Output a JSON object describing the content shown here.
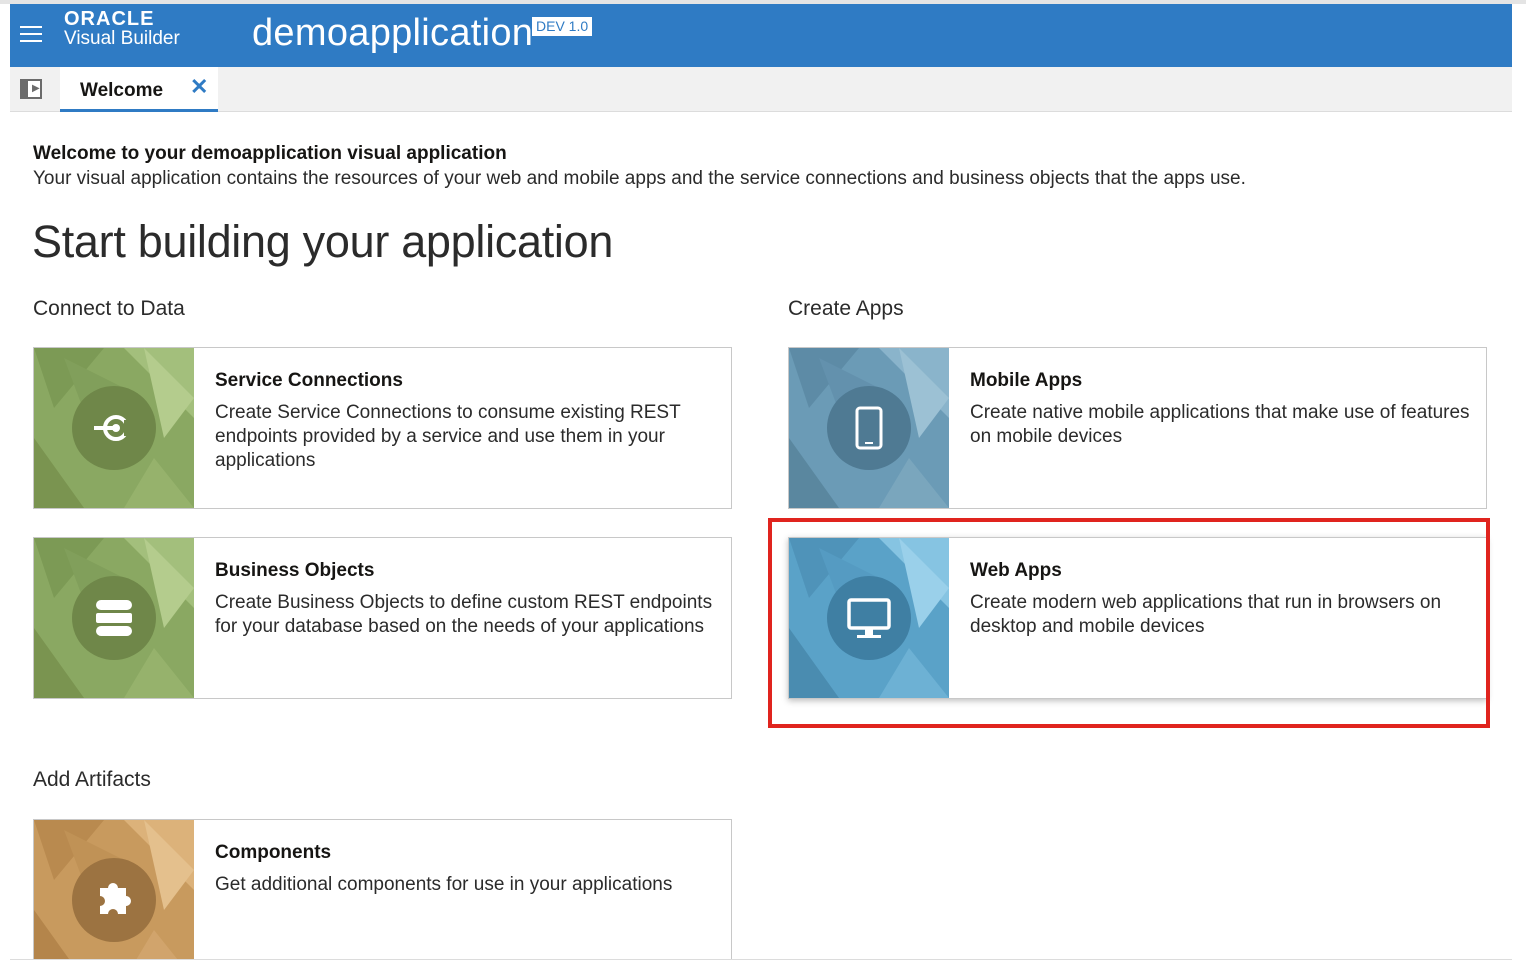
{
  "header": {
    "brand_oracle": "ORACLE",
    "brand_product": "Visual Builder",
    "app_name": "demoapplication",
    "version_badge": "DEV 1.0",
    "color": "#2f7bc4"
  },
  "tabs": [
    {
      "label": "Welcome",
      "close": "✕"
    }
  ],
  "welcome": {
    "title": "Welcome to your demoapplication visual application",
    "description": "Your visual application contains the resources of your web and mobile apps and the service connections and business objects that the apps use."
  },
  "main": {
    "heading": "Start building your application",
    "sections": {
      "connect": "Connect to Data",
      "create": "Create Apps",
      "artifacts": "Add Artifacts"
    }
  },
  "cards": {
    "service_connections": {
      "title": "Service Connections",
      "description": "Create Service Connections to consume existing REST endpoints provided by a service and use them in your applications",
      "icon": "service-connection-icon",
      "color": "#8aa862"
    },
    "business_objects": {
      "title": "Business Objects",
      "description": "Create Business Objects to define custom REST endpoints for your database based on the needs of your applications",
      "icon": "database-icon",
      "color": "#8aa862"
    },
    "mobile_apps": {
      "title": "Mobile Apps",
      "description": "Create native mobile applications that make use of features on mobile devices",
      "icon": "mobile-icon",
      "color": "#6b9bb6"
    },
    "web_apps": {
      "title": "Web Apps",
      "description": "Create modern web applications that run in browsers on desktop and mobile devices",
      "icon": "monitor-icon",
      "color": "#5aa2c8"
    },
    "components": {
      "title": "Components",
      "description": "Get additional components for use in your applications",
      "icon": "puzzle-icon",
      "color": "#c89a5e"
    }
  },
  "highlight_color": "#e0241e"
}
